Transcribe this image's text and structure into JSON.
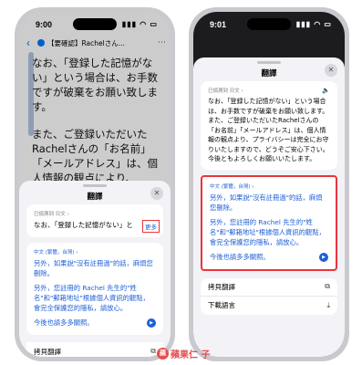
{
  "left_phone": {
    "status_time": "9:00",
    "status_icons": "▮▮▮ ◠ ▭",
    "mail": {
      "back_glyph": "‹",
      "subject": "【要確認】Rachelさん...",
      "body_paragraph_1": "なお、「登録した記憶がない」という場合は、お手数ですが破棄をお願い致します。",
      "body_paragraph_2": "また、ご登録いただいたRachelさんの「お名前」「メールアドレス」は、個人情報の観点により、"
    },
    "sheet": {
      "title": "翻譯",
      "close_glyph": "✕",
      "source_lang": "已偵測到 日文 ›",
      "source_text": "なお、「登録した記憶がない」と",
      "more_label": "更多",
      "target_lang": "中文 (繁體，台灣) ›",
      "translation_1": "另外，如果說\"沒有註冊過\"的話，麻煩您刪除。",
      "translation_2": "另外，您註冊的 Rachel 先生的\"姓名\"和\"郵箱地址\"根據個人資訊的觀點，會完全保護您的隱私，請放心。",
      "footer_line": "今後也請多多關照。",
      "rows": [
        {
          "label": "拷貝翻譯",
          "icon": "⧉"
        }
      ]
    }
  },
  "right_phone": {
    "status_time": "9:01",
    "status_icons": "▮▮▮ ◠ ▭",
    "sheet": {
      "title": "翻譯",
      "close_glyph": "✕",
      "source_lang": "已偵測到 日文 ›",
      "source_text": "なお、「登録した記憶がない」という場合は、お手数ですが破棄をお願い致します。\nまた、ご登録いただいたRachelさんの「お名前」「メールアドレス」は、個人情報の観点より、プライバシーは完全にお守りいたしますので、どうぞご安心下さい。\n今後ともよろしくお願いいたします。",
      "target_lang": "中文 (繁體，台灣) ›",
      "translation_1": "另外，如果說\"沒有註冊過\"的話，麻煩您刪除。",
      "translation_2": "另外，您註冊的 Rachel 先生的\"姓名\"和\"郵箱地址\"根據個人資訊的觀點，會完全保護您的隱私，請放心。",
      "footer_line": "今後也請多多關照。",
      "rows": [
        {
          "label": "拷貝翻譯",
          "icon": "⧉"
        },
        {
          "label": "下載語言",
          "icon": "⤓"
        }
      ]
    }
  },
  "watermark": {
    "logo_glyph": "蘋",
    "text": "蘋果仁 子"
  },
  "colors": {
    "accent_blue": "#1d5fd6",
    "highlight_red": "#e8353b"
  }
}
